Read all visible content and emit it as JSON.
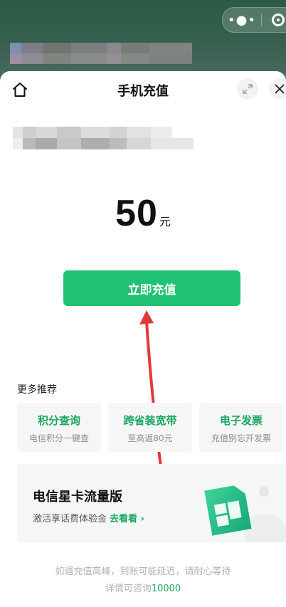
{
  "header": {
    "title": "手机充值"
  },
  "recharge": {
    "amount": "50",
    "unit": "元",
    "cta_label": "立即充值"
  },
  "more": {
    "title": "更多推荐",
    "cards": [
      {
        "title": "积分查询",
        "subtitle": "电信积分一键查"
      },
      {
        "title": "跨省装宽带",
        "subtitle": "至高返80元"
      },
      {
        "title": "电子发票",
        "subtitle": "充值别忘开发票"
      }
    ]
  },
  "promo": {
    "title": "电信星卡流量版",
    "subtitle": "激活享话费体验金",
    "link": "去看看"
  },
  "notice": {
    "line1": "如遇充值高峰，到账可能延迟，请耐心等待",
    "line2_prefix": "详情可咨询",
    "line2_number": "10000"
  },
  "colors": {
    "accent": "#22c274",
    "link_green": "#1aa862",
    "annotation_arrow": "#e53935"
  }
}
